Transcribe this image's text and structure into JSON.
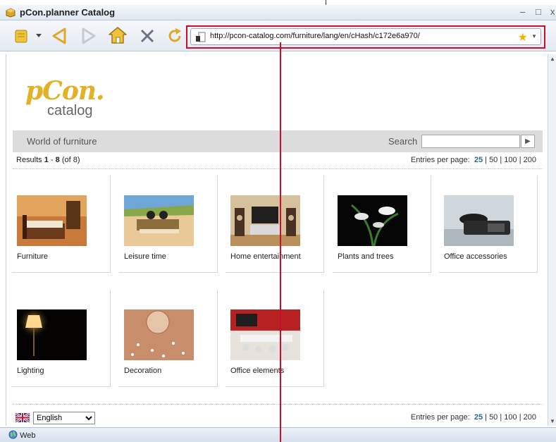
{
  "window": {
    "title": "pCon.planner Catalog",
    "min_label": "–",
    "max_label": "□",
    "close_label": "x"
  },
  "toolbar": {
    "url": "http://pcon-catalog.com/furniture/lang/en/cHash/c172e6a970/",
    "highlight_color": "#c8102e"
  },
  "page": {
    "logo": {
      "brand": "pCon.",
      "sub": "catalog"
    },
    "nav": {
      "title": "World of furniture",
      "search_label": "Search",
      "search_value": ""
    },
    "results": {
      "prefix": "Results ",
      "from": "1",
      "dash": " - ",
      "to": "8",
      "total": " (of 8)"
    },
    "entries": {
      "label": "Entries per page:",
      "options": [
        "25",
        "50",
        "100",
        "200"
      ],
      "current": "25"
    },
    "categories": [
      {
        "label": "Furniture"
      },
      {
        "label": "Leisure time"
      },
      {
        "label": "Home entertainment"
      },
      {
        "label": "Plants and trees"
      },
      {
        "label": "Office accessories"
      },
      {
        "label": "Lighting"
      },
      {
        "label": "Decoration"
      },
      {
        "label": "Office elements"
      }
    ],
    "language": {
      "selected": "English"
    }
  },
  "status": {
    "zone": "Web"
  }
}
